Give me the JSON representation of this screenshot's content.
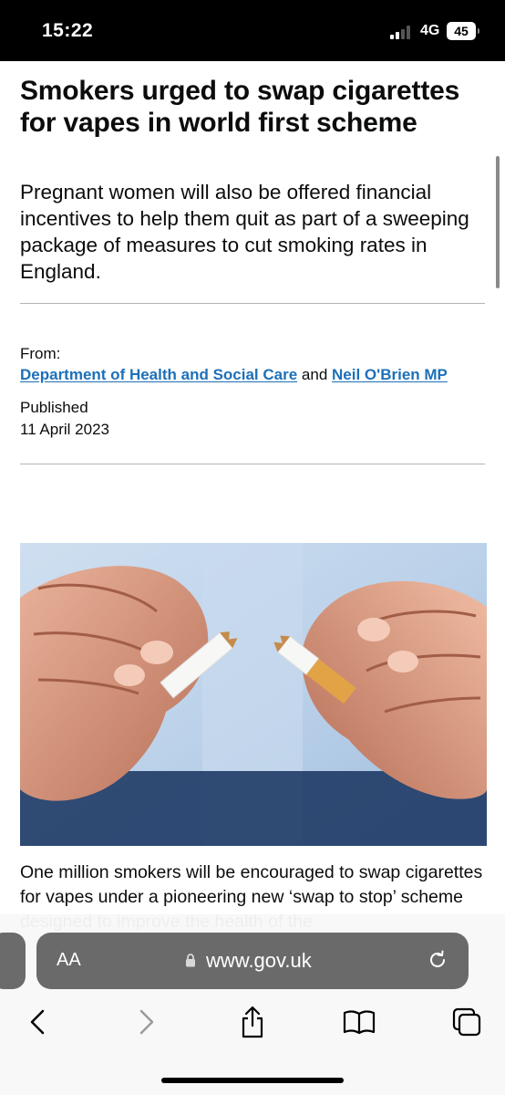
{
  "status_bar": {
    "time": "15:22",
    "network": "4G",
    "battery": "45"
  },
  "article": {
    "headline": "Smokers urged to swap cigarettes for vapes in world first scheme",
    "lede": "Pregnant women will also be offered financial incentives to help them quit as part of a sweeping package of measures to cut smoking rates in England.",
    "from_label": "From:",
    "from_org": "Department of Health and Social Care",
    "from_and": "and",
    "from_person": "Neil O'Brien MP",
    "published_label": "Published",
    "published_date": "11 April 2023",
    "body_start": "One million smokers will be encouraged to swap cigarettes for vapes under a pioneering new ‘swap to stop’ scheme designed to improve the health of the"
  },
  "browser": {
    "text_size_label": "AA",
    "url": "www.gov.uk",
    "toolbar": [
      "back-icon",
      "forward-icon",
      "share-icon",
      "bookmarks-icon",
      "tabs-icon"
    ]
  },
  "colors": {
    "link": "#1d70b8",
    "text": "#0b0c0c",
    "divider": "#b1b4b6"
  }
}
